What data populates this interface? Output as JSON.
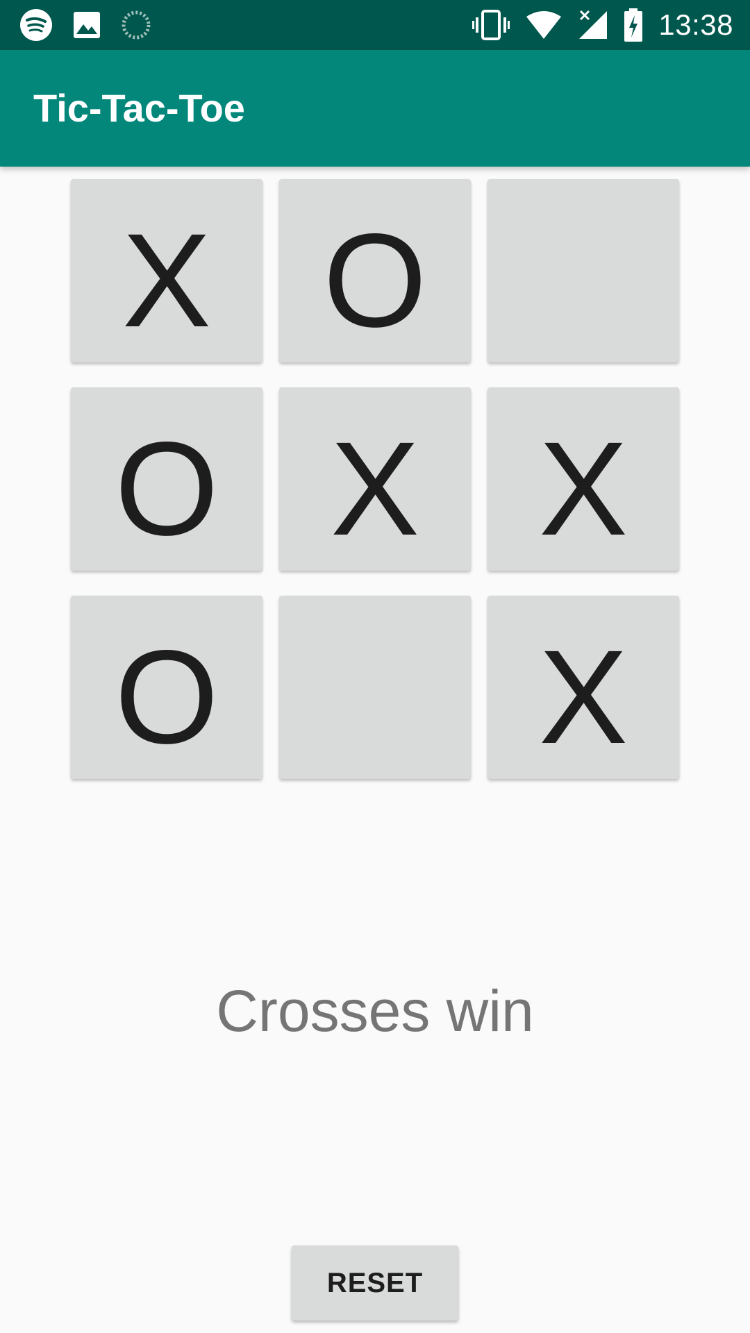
{
  "status_bar": {
    "left_icons": [
      "spotify-icon",
      "image-icon",
      "loading-icon"
    ],
    "right_icons": [
      "vibrate-icon",
      "wifi-icon",
      "signal-icon",
      "battery-charging-icon"
    ],
    "time": "13:38",
    "background": "#00574d"
  },
  "app_bar": {
    "title": "Tic-Tac-Toe",
    "background": "#02877a"
  },
  "board": {
    "cells": [
      [
        "X",
        "O",
        ""
      ],
      [
        "O",
        "X",
        "X"
      ],
      [
        "O",
        "",
        "X"
      ]
    ]
  },
  "result": {
    "text": "Crosses win"
  },
  "reset": {
    "label": "RESET"
  }
}
